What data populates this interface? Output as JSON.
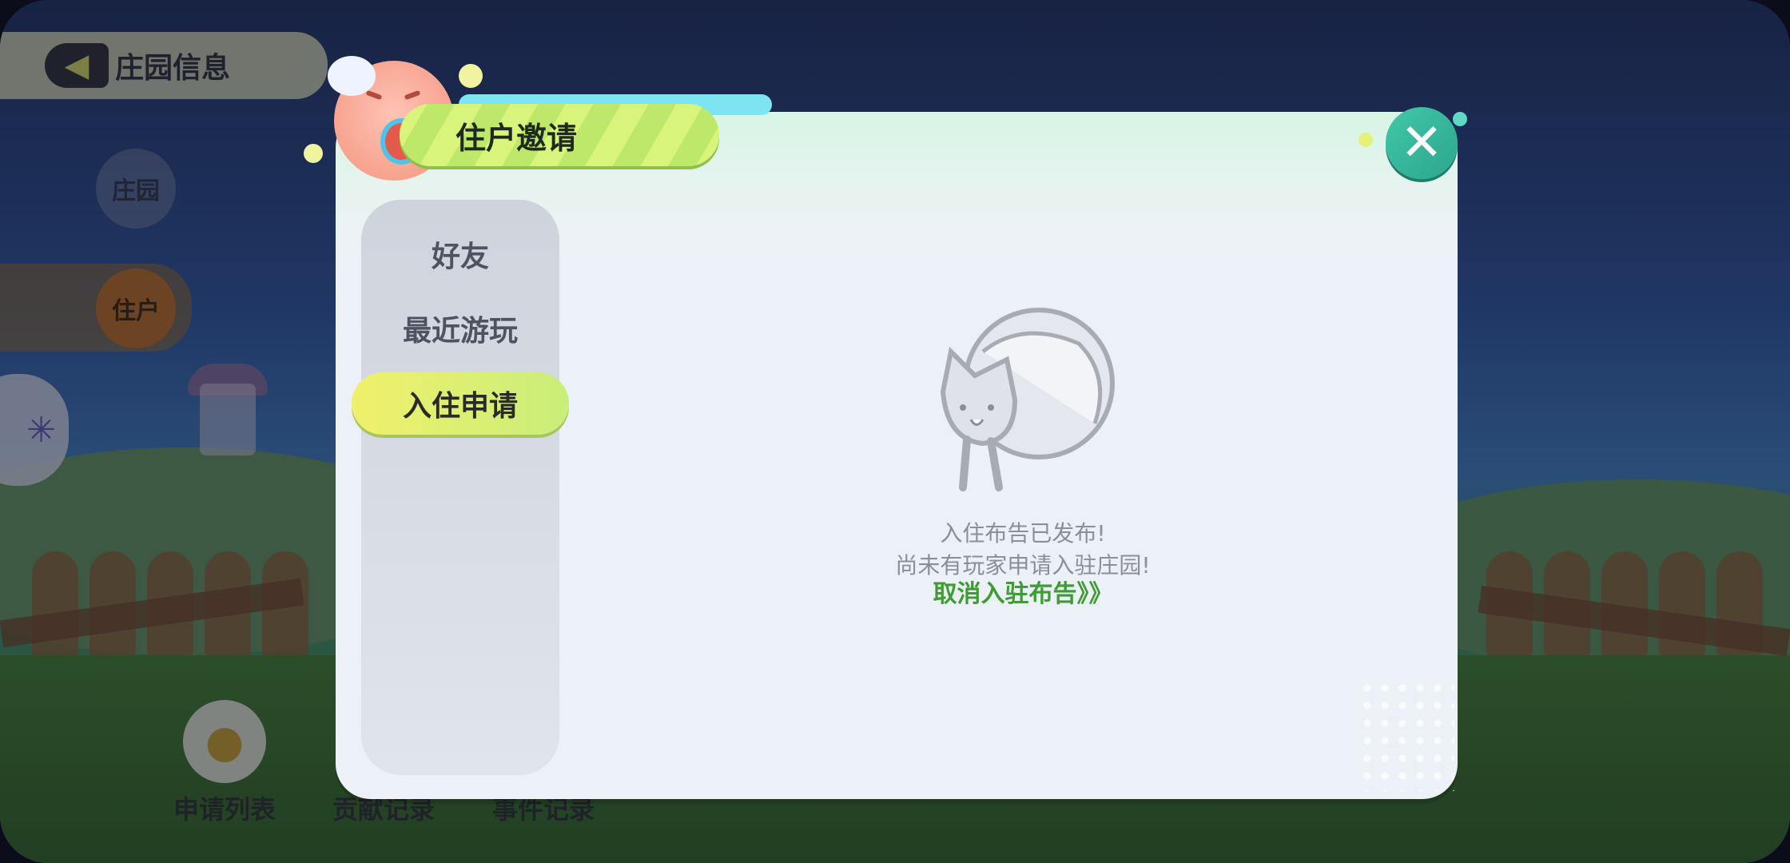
{
  "header": {
    "title": "庄园信息",
    "back_icon": "back-arrow-icon"
  },
  "side_nav": {
    "manor": "庄园",
    "resident": "住户"
  },
  "bottom": {
    "apply_list": "申请列表",
    "contrib_record": "贡献记录",
    "event_record": "事件记录"
  },
  "dialog": {
    "title": "住户邀请",
    "close_icon": "close-icon",
    "tabs": [
      {
        "label": "好友"
      },
      {
        "label": "最近游玩"
      },
      {
        "label": "入住申请",
        "selected": true
      }
    ],
    "empty": {
      "line1": "入住布告已发布!",
      "line2": "尚未有玩家申请入驻庄园!",
      "cancel_link": "取消入驻布告》》"
    }
  },
  "colors": {
    "accent_green": "#3f9b34",
    "selected_tab": "#f0f06a",
    "close_button": "#42c7a8"
  }
}
